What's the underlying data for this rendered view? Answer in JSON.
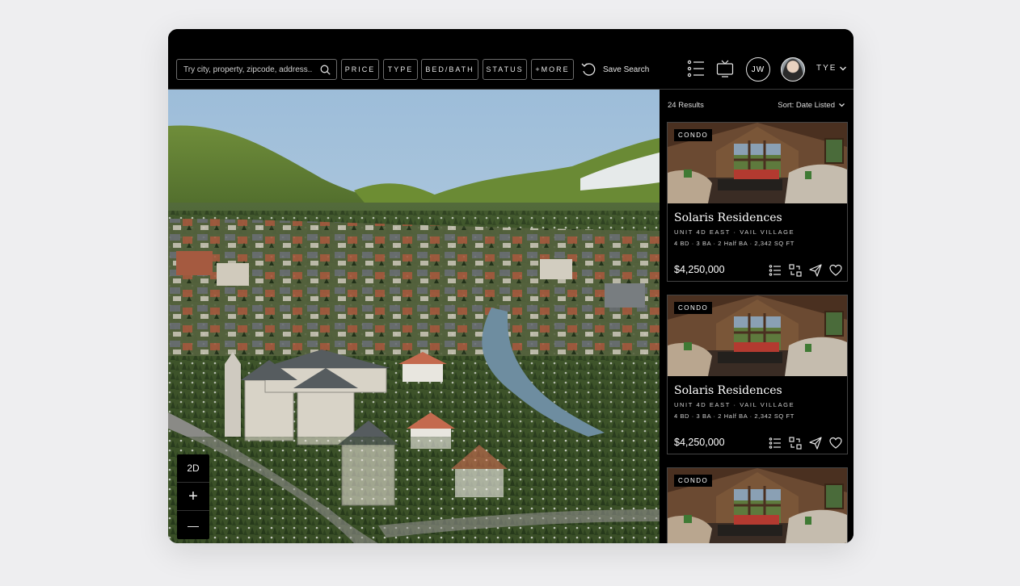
{
  "search": {
    "placeholder": "Try city, property, zipcode, address..."
  },
  "filters": [
    "PRICE",
    "TYPE",
    "BED/BATH",
    "STATUS",
    "+MORE"
  ],
  "save_search_label": "Save Search",
  "user": {
    "initials": "JW",
    "name": "TYE"
  },
  "map_controls": {
    "mode": "2D",
    "zoom_in": "+",
    "zoom_out": "—"
  },
  "results": {
    "count_label": "24 Results",
    "sort_label": "Sort: Date Listed"
  },
  "listings": [
    {
      "badge": "CONDO",
      "title": "Solaris Residences",
      "subtitle": "UNIT 4D EAST · VAIL VILLAGE",
      "meta": "4 BD · 3 BA · 2 Half BA · 2,342 SQ FT",
      "price": "$4,250,000"
    },
    {
      "badge": "CONDO",
      "title": "Solaris Residences",
      "subtitle": "UNIT 4D EAST · VAIL VILLAGE",
      "meta": "4 BD · 3 BA · 2 Half BA · 2,342 SQ FT",
      "price": "$4,250,000"
    },
    {
      "badge": "CONDO"
    }
  ],
  "colors": {
    "background": "#000000",
    "page": "#eeeef0",
    "border": "#6c6c6c",
    "text": "#ffffff"
  }
}
